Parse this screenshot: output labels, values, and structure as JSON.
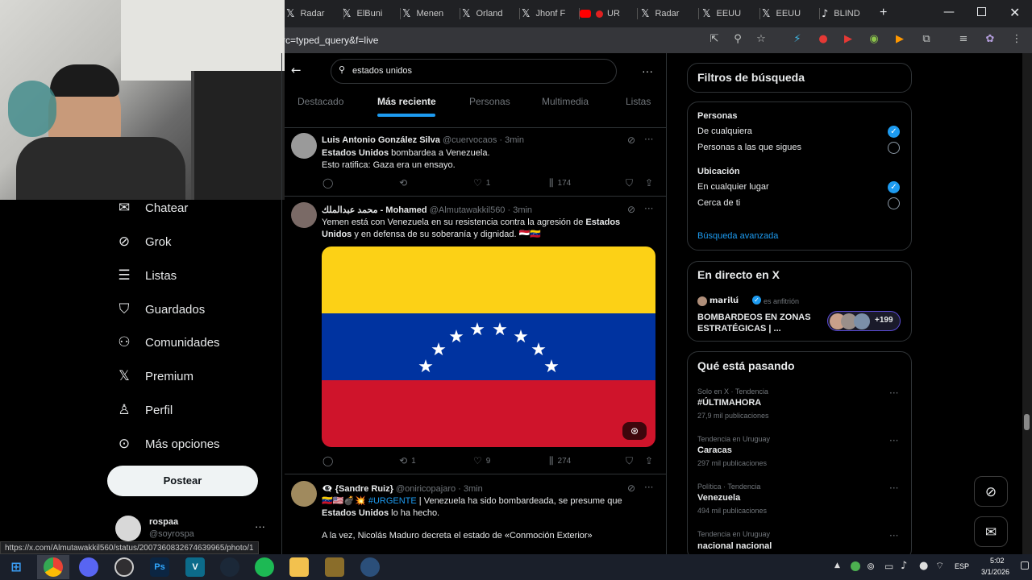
{
  "browser": {
    "tabs": [
      {
        "label": "Radar",
        "icon": "x-icon"
      },
      {
        "label": "ElBuni",
        "icon": "x-icon"
      },
      {
        "label": "Menen",
        "icon": "x-icon"
      },
      {
        "label": "Orland",
        "icon": "x-icon"
      },
      {
        "label": "Jhonf F",
        "icon": "x-icon"
      },
      {
        "label": "UR",
        "icon": "youtube-icon"
      },
      {
        "label": "Radar",
        "icon": "x-icon"
      },
      {
        "label": "EEUU",
        "icon": "x-icon"
      },
      {
        "label": "EEUU",
        "icon": "x-icon"
      },
      {
        "label": "BLIND",
        "icon": "tiktok-icon"
      }
    ],
    "new_tab": "+",
    "url": "rc=typed_query&f=live",
    "status_url": "https://x.com/Almutawakkil560/status/2007360832674639965/photo/1"
  },
  "nav": {
    "items": [
      {
        "label": "Chatear",
        "icon": "envelope-icon"
      },
      {
        "label": "Grok",
        "icon": "grok-icon"
      },
      {
        "label": "Listas",
        "icon": "list-icon"
      },
      {
        "label": "Guardados",
        "icon": "bookmark-icon"
      },
      {
        "label": "Comunidades",
        "icon": "communities-icon"
      },
      {
        "label": "Premium",
        "icon": "x-logo-icon"
      },
      {
        "label": "Perfil",
        "icon": "person-icon"
      },
      {
        "label": "Más opciones",
        "icon": "more-circle-icon"
      }
    ],
    "post_button": "Postear",
    "account": {
      "name": "rospaa",
      "handle": "@soyrospa"
    }
  },
  "search": {
    "query": "estados unidos",
    "tabs": [
      "Destacado",
      "Más reciente",
      "Personas",
      "Multimedia",
      "Listas"
    ],
    "active_tab": "Más reciente"
  },
  "tweets": [
    {
      "name": "Luis Antonio González Silva",
      "handle": "@cuervocaos · 3min",
      "line1_bold": "Estados Unidos",
      "line1_rest": " bombardea a Venezuela.",
      "line2": "Esto ratifica: Gaza era un ensayo.",
      "replies": "",
      "reposts": "",
      "likes": "1",
      "views": "174"
    },
    {
      "name": "محمد عبدالملك - Mohamed",
      "handle": "@Almutawakkil560 · 3min",
      "text_a": "Yemen está con Venezuela en su resistencia contra la agresión de ",
      "text_bold_a": "Estados",
      "text_bold_b": "Unidos",
      "text_b": " y en defensa de su soberanía y dignidad. 🇾🇪🇻🇪",
      "replies": "",
      "reposts": "1",
      "likes": "9",
      "views": "274",
      "flag_colors": [
        "#fcd116",
        "#0033a0",
        "#cf142b"
      ]
    },
    {
      "name": "👁‍🗨 {Sandre Ruiz}",
      "handle": "@oniricopajaro · 3min",
      "prefix": "🇻🇪🇺🇸💣💥 ",
      "hashtag": "#URGENTE",
      "text_a": " | Venezuela ha sido bombardeada, se presume que",
      "text_bold": "Estados Unidos",
      "text_b": " lo ha hecho.",
      "text_c": "A la vez, Nicolás Maduro decreta el estado de «Conmoción Exterior»"
    }
  ],
  "filters": {
    "title": "Filtros de búsqueda",
    "people_heading": "Personas",
    "people_options": [
      "De cualquiera",
      "Personas a las que sigues"
    ],
    "location_heading": "Ubicación",
    "location_options": [
      "En cualquier lugar",
      "Cerca de ti"
    ],
    "advanced": "Búsqueda avanzada"
  },
  "live": {
    "title": "En directo en X",
    "host": "𝗺𝗮𝗿𝗶𝗹𝘂́",
    "host_suffix": "es anfitrión",
    "topic_line1": "BOMBARDEOS EN ZONAS",
    "topic_line2": "ESTRATÉGICAS | ...",
    "listeners": "+199"
  },
  "trends": {
    "title": "Qué está pasando",
    "items": [
      {
        "context": "Solo en X · Tendencia",
        "name": "#ÚLTIMAHORA",
        "count": "27,9 mil publicaciones"
      },
      {
        "context": "Tendencia en Uruguay",
        "name": "Caracas",
        "count": "297 mil publicaciones"
      },
      {
        "context": "Política · Tendencia",
        "name": "Venezuela",
        "count": "494 mil publicaciones"
      },
      {
        "context": "Tendencia en Uruguay",
        "name": "nacional nacional",
        "count": ""
      }
    ]
  },
  "taskbar": {
    "apps": [
      "windows-start-icon",
      "chrome-icon",
      "discord-icon",
      "obs-icon",
      "photoshop-icon",
      "vegas-icon",
      "steam-icon",
      "spotify-icon",
      "file-explorer-icon",
      "league-icon",
      "refresh-app-icon"
    ],
    "lang": "ESP",
    "time": "5:02",
    "date": "3/1/2026",
    "photoshop_label": "Ps",
    "vegas_label": "V"
  },
  "colors": {
    "accent": "#1d9bf0",
    "text": "#e7e9ea",
    "muted": "#71767b",
    "border": "#2f3336"
  }
}
